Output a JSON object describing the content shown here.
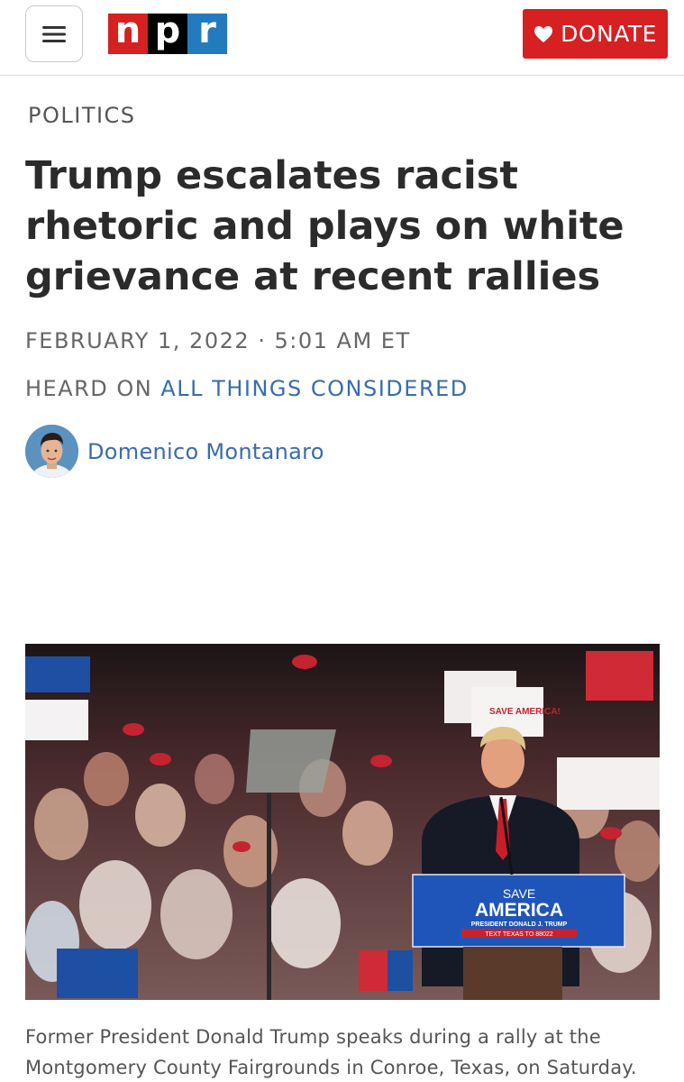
{
  "header": {
    "menu_icon": "hamburger-menu-icon",
    "logo": {
      "letters": [
        "n",
        "p",
        "r"
      ],
      "colors": [
        "#d62021",
        "#000000",
        "#237bbd"
      ]
    },
    "donate_label": "DONATE",
    "donate_icon": "heart-icon",
    "accent_color": "#d62021"
  },
  "article": {
    "section": "POLITICS",
    "headline": "Trump escalates racist rhetoric and plays on white grievance at recent rallies",
    "dateline": "FEBRUARY 1, 2022 · 5:01 AM ET",
    "heard_prefix": "HEARD ON ",
    "heard_show": "ALL THINGS CONSIDERED",
    "author": "Domenico Montanaro",
    "photo": {
      "sign_text": "SAVE AMERICA!",
      "podium_line1": "SAVE",
      "podium_line2": "AMERICA",
      "podium_line3": "PRESIDENT DONALD J. TRUMP",
      "podium_line4": "TEXT TEXAS TO 88022"
    },
    "caption": "Former President Donald Trump speaks during a rally at the Montgomery County Fairgrounds in Conroe, Texas, on Saturday."
  },
  "colors": {
    "link": "#3a6bb0",
    "meta_text": "#666666"
  }
}
